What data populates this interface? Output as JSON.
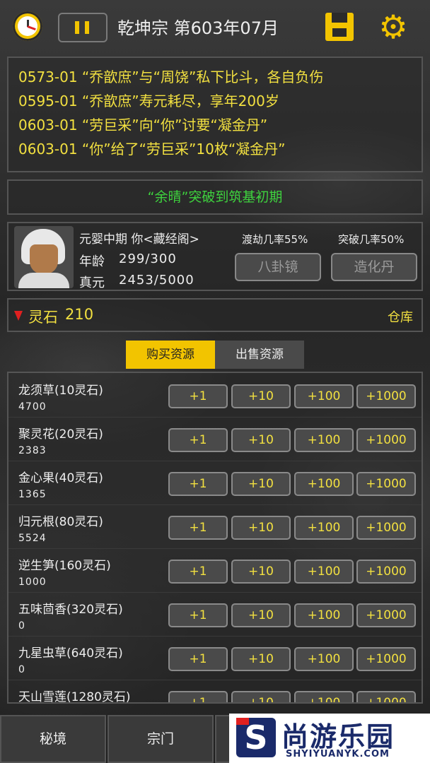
{
  "header": {
    "title": "乾坤宗 第603年07月"
  },
  "log": [
    "0573-01 “乔歆庶”与“周饶”私下比斗，各自负伤",
    "0595-01 “乔歆庶”寿元耗尽，享年200岁",
    "0603-01 “劳巨采”向“你”讨要“凝金丹”",
    "0603-01 “你”给了“劳巨采”10枚“凝金丹”"
  ],
  "event": "“余晴”突破到筑基初期",
  "character": {
    "rank": "元婴中期 你<藏经阁>",
    "age_label": "年龄",
    "age_value": "299/300",
    "qi_label": "真元",
    "qi_value": "2453/5000",
    "tribulation_rate": "渡劫几率55%",
    "breakthrough_rate": "突破几率50%",
    "item_button_1": "八卦镜",
    "item_button_2": "造化丹"
  },
  "stones": {
    "label": "灵石",
    "value": "210",
    "storage": "仓库"
  },
  "tabs": {
    "buy": "购买资源",
    "sell": "出售资源"
  },
  "qty_buttons": [
    "+1",
    "+10",
    "+100",
    "+1000"
  ],
  "resources": [
    {
      "name": "龙须草(10灵石)",
      "count": "4700"
    },
    {
      "name": "聚灵花(20灵石)",
      "count": "2383"
    },
    {
      "name": "金心果(40灵石)",
      "count": "1365"
    },
    {
      "name": "归元根(80灵石)",
      "count": "5524"
    },
    {
      "name": "逆生笋(160灵石)",
      "count": "1000"
    },
    {
      "name": "五味茴香(320灵石)",
      "count": "0"
    },
    {
      "name": "九星虫草(640灵石)",
      "count": "0"
    },
    {
      "name": "天山雪莲(1280灵石)",
      "count": ""
    }
  ],
  "nav": {
    "item1": "秘境",
    "item2": "宗门"
  },
  "watermark": {
    "logo_letter": "S",
    "text": "尚游乐园",
    "url": "SHYIYUANYK.COM"
  },
  "colors": {
    "accent": "#f2c400",
    "log_text": "#f2e040",
    "event_text": "#3ed23e",
    "indicator": "#e02020"
  }
}
